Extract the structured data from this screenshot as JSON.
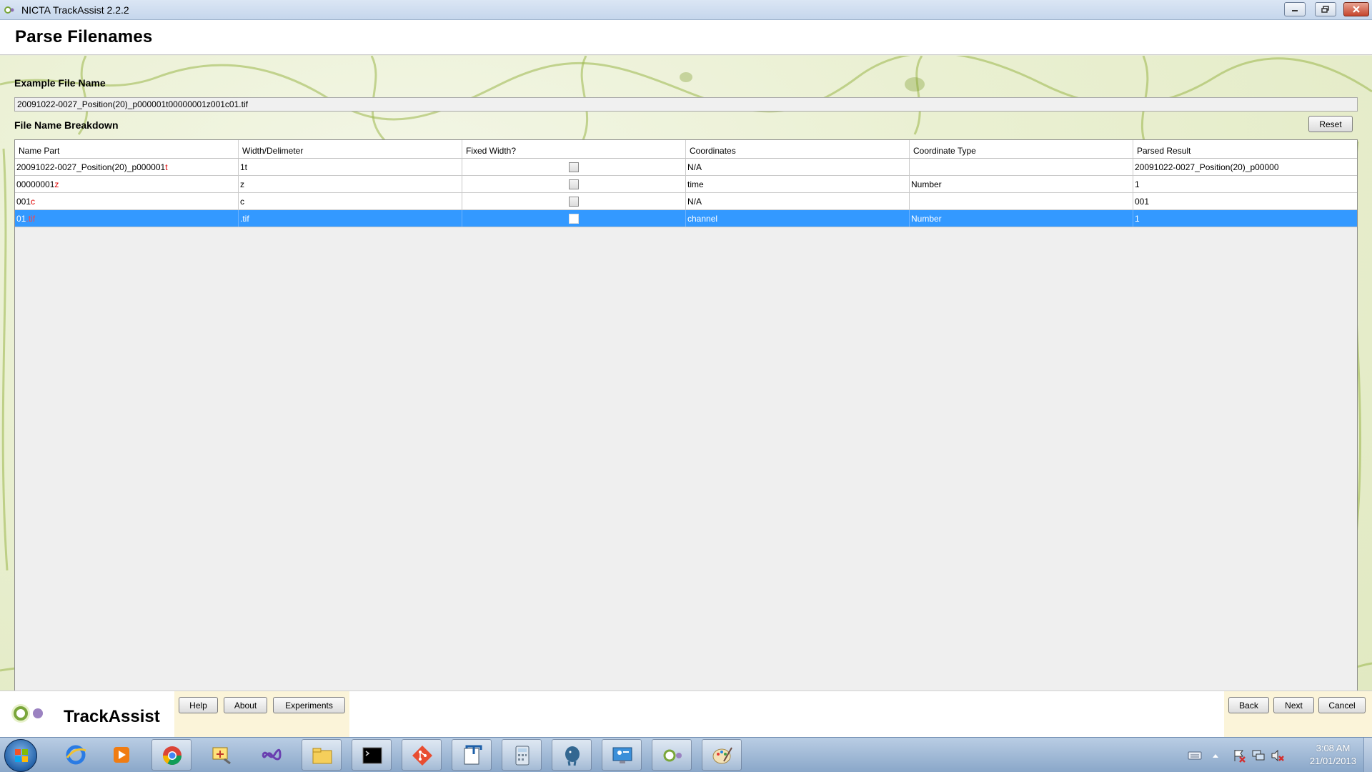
{
  "window": {
    "title": "NICTA TrackAssist 2.2.2",
    "controls": {
      "minimize": "minimize",
      "restore": "restore",
      "close": "close"
    }
  },
  "header": {
    "title": "Parse Filenames"
  },
  "example": {
    "label": "Example File Name",
    "value": "20091022-0027_Position(20)_p000001t00000001z001c01.tif"
  },
  "breakdown": {
    "label": "File Name Breakdown",
    "reset_label": "Reset",
    "columns": [
      "Name Part",
      "Width/Delimeter",
      "Fixed Width?",
      "Coordinates",
      "Coordinate Type",
      "Parsed Result"
    ],
    "rows": [
      {
        "name_part_plain": "20091022-0027_Position(20)_p000001",
        "name_part_delim": "t",
        "width": "1t",
        "fixed": false,
        "coordinates": "N/A",
        "coord_type": "",
        "parsed": "20091022-0027_Position(20)_p00000"
      },
      {
        "name_part_plain": "00000001",
        "name_part_delim": "z",
        "width": "z",
        "fixed": false,
        "coordinates": "time",
        "coord_type": "Number",
        "parsed": "1"
      },
      {
        "name_part_plain": "001",
        "name_part_delim": "c",
        "width": "c",
        "fixed": false,
        "coordinates": "N/A",
        "coord_type": "",
        "parsed": "001"
      },
      {
        "name_part_plain": "01",
        "name_part_delim": ".tif",
        "width": ".tif",
        "fixed": false,
        "coordinates": "channel",
        "coord_type": "Number",
        "parsed": "1",
        "selected": true
      }
    ]
  },
  "footer": {
    "brand": "TrackAssist",
    "left_buttons": [
      "Help",
      "About",
      "Experiments"
    ],
    "right_buttons": [
      "Back",
      "Next",
      "Cancel"
    ]
  },
  "taskbar": {
    "items": [
      "ie-icon",
      "media-player-icon",
      "chrome-icon",
      "snipping-tool-icon",
      "visual-studio-icon",
      "file-explorer-icon",
      "command-prompt-icon",
      "git-icon",
      "text-editor-icon",
      "calculator-icon",
      "postgresql-icon",
      "remote-desktop-icon",
      "trackassist-icon",
      "paint-icon"
    ],
    "time": "3:08 AM",
    "date": "21/01/2013"
  },
  "colors": {
    "accent_selection": "#3399ff",
    "delimiter_red": "#e00000",
    "footer_panel": "#fbf4d9"
  }
}
